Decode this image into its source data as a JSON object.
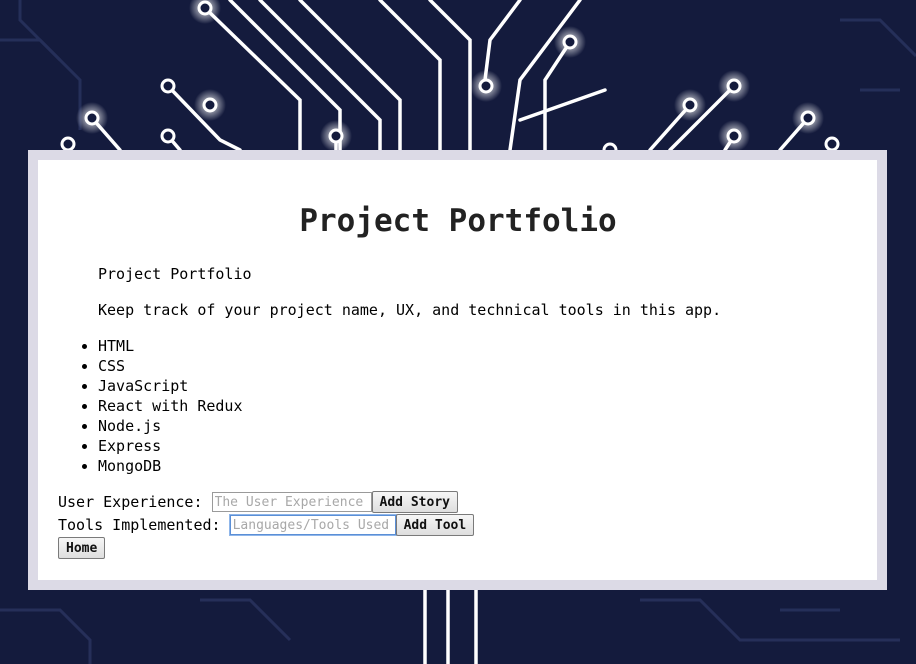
{
  "page": {
    "title": "Project Portfolio",
    "subtitle": "Project Portfolio",
    "description": "Keep track of your project name, UX, and technical tools in this app."
  },
  "tools_list": [
    "HTML",
    "CSS",
    "JavaScript",
    "React with Redux",
    "Node.js",
    "Express",
    "MongoDB"
  ],
  "form": {
    "ux_label": "User Experience: ",
    "ux_placeholder": "The User Experience Achieved",
    "add_story_label": "Add Story",
    "tools_label": "Tools Implemented: ",
    "tools_placeholder": "Languages/Tools Used",
    "add_tool_label": "Add Tool",
    "home_label": "Home"
  },
  "colors": {
    "background": "#141b3d",
    "circuit": "#ffffff",
    "panel_border": "#dcdae6",
    "panel": "#ffffff"
  }
}
